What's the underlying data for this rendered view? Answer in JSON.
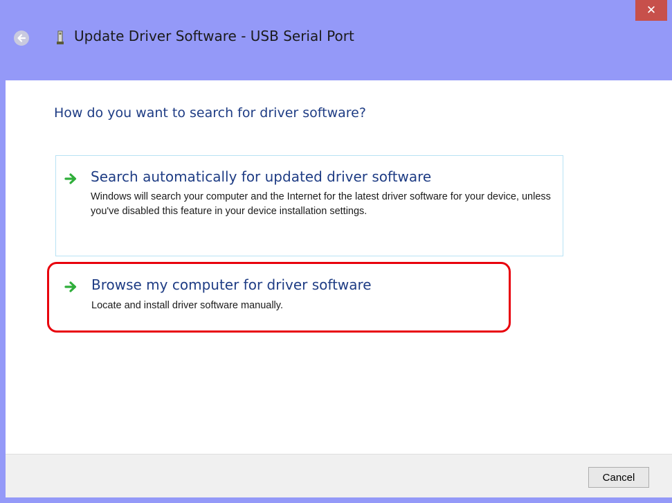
{
  "window": {
    "title": "Update Driver Software - USB Serial Port",
    "close_icon": "close-icon",
    "back_icon": "back-arrow-icon",
    "device_icon": "usb-device-icon"
  },
  "content": {
    "question": "How do you want to search for driver software?",
    "options": [
      {
        "icon": "green-arrow-icon",
        "title": "Search automatically for updated driver software",
        "description": "Windows will search your computer and the Internet for the latest driver software for your device, unless you've disabled this feature in your device installation settings."
      },
      {
        "icon": "green-arrow-icon",
        "title": "Browse my computer for driver software",
        "description": "Locate and install driver software manually.",
        "highlighted": true
      }
    ]
  },
  "footer": {
    "cancel_label": "Cancel"
  },
  "colors": {
    "frame": "#9499f8",
    "close_button": "#c7504b",
    "heading": "#1e3c84",
    "highlight_border": "#e8000c",
    "option_border": "#b8e2f4",
    "arrow": "#2fae3a"
  }
}
